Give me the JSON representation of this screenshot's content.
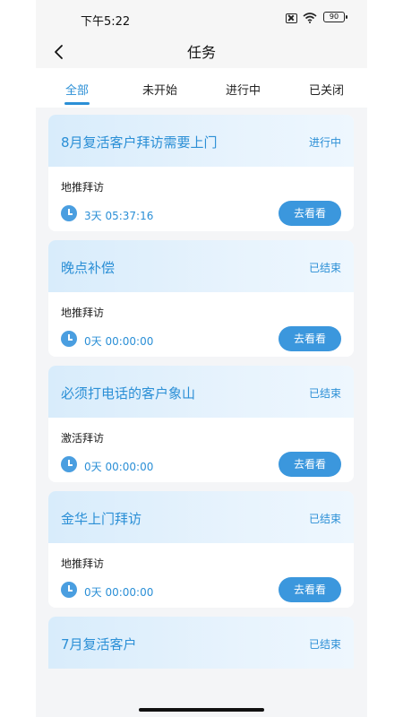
{
  "status_bar": {
    "time": "下午5:22",
    "battery": "90"
  },
  "nav": {
    "title": "任务"
  },
  "tabs": [
    {
      "label": "全部",
      "active": true
    },
    {
      "label": "未开始",
      "active": false
    },
    {
      "label": "进行中",
      "active": false
    },
    {
      "label": "已关闭",
      "active": false
    }
  ],
  "tasks": [
    {
      "title": "8月复活客户拜访需要上门",
      "status": "进行中",
      "type": "地推拜访",
      "time": "3天 05:37:16",
      "button": "去看看"
    },
    {
      "title": "晚点补偿",
      "status": "已结束",
      "type": "地推拜访",
      "time": "0天 00:00:00",
      "button": "去看看"
    },
    {
      "title": "必须打电话的客户象山",
      "status": "已结束",
      "type": "激活拜访",
      "time": "0天 00:00:00",
      "button": "去看看"
    },
    {
      "title": "金华上门拜访",
      "status": "已结束",
      "type": "地推拜访",
      "time": "0天 00:00:00",
      "button": "去看看"
    },
    {
      "title": "7月复活客户",
      "status": "已结束"
    }
  ],
  "colors": {
    "accent": "#2b8fd6",
    "button": "#3b97dd"
  }
}
